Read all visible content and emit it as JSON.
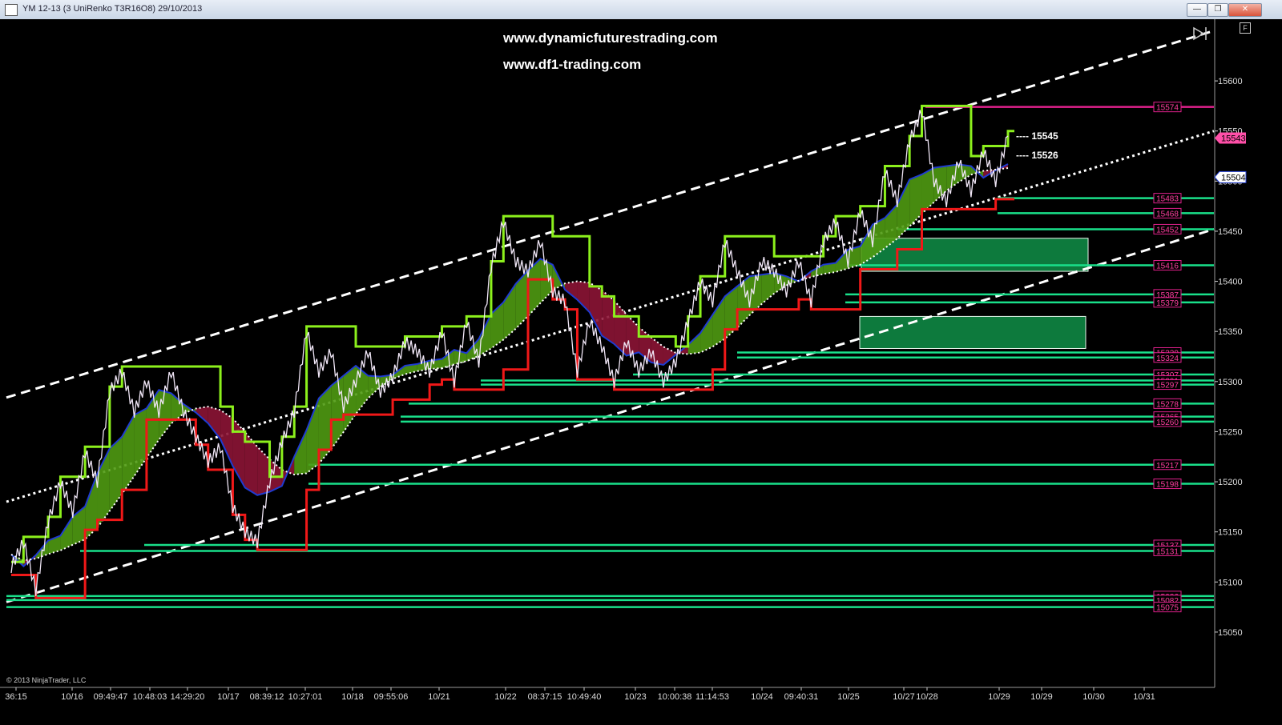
{
  "window": {
    "title": "YM 12-13 (3 UniRenko T3R16O8)  29/10/2013",
    "minimize_glyph": "—",
    "maximize_glyph": "❐",
    "close_glyph": "✕",
    "f_button": "F"
  },
  "chart_data": {
    "type": "line",
    "instrument": "YM 12-13",
    "watermarks": [
      "www.dynamicfuturestrading.com",
      "www.df1-trading.com"
    ],
    "copyright": "© 2013 NinjaTrader, LLC",
    "y_axis": {
      "range": [
        15010,
        15640
      ],
      "ticks": [
        15050,
        15100,
        15150,
        15200,
        15250,
        15300,
        15350,
        15400,
        15450,
        15500,
        15550,
        15600
      ]
    },
    "x_ticks": [
      "36:15",
      "10/16",
      "09:49:47",
      "10:48:03",
      "14:29:20",
      "10/17",
      "08:39:12",
      "10:27:01",
      "10/18",
      "09:55:06",
      "10/21",
      "10/22",
      "08:37:15",
      "10:49:40",
      "10/23",
      "10:00:38",
      "11:14:53",
      "10/24",
      "09:40:31",
      "10/25",
      "10/27",
      "10/28",
      "10/29",
      "10/29",
      "10/30",
      "10/31"
    ],
    "last_price": 15543,
    "marker_price": 15504,
    "target_labels": [
      {
        "value": 15545,
        "text": "---- 15545"
      },
      {
        "value": 15526,
        "text": "---- 15526"
      }
    ],
    "horizontal_levels": [
      {
        "value": 15574,
        "label": "15574"
      },
      {
        "value": 15483,
        "label": "15483"
      },
      {
        "value": 15468,
        "label": "15468"
      },
      {
        "value": 15452,
        "label": "15452"
      },
      {
        "value": 15416,
        "label": "15416"
      },
      {
        "value": 15387,
        "label": "15387"
      },
      {
        "value": 15379,
        "label": "15379"
      },
      {
        "value": 15329,
        "label": "15329"
      },
      {
        "value": 15324,
        "label": "15324"
      },
      {
        "value": 15307,
        "label": "15307"
      },
      {
        "value": 15301,
        "label": "15301"
      },
      {
        "value": 15297,
        "label": "15297"
      },
      {
        "value": 15278,
        "label": "15278"
      },
      {
        "value": 15265,
        "label": "15265"
      },
      {
        "value": 15260,
        "label": "15260"
      },
      {
        "value": 15217,
        "label": "15217"
      },
      {
        "value": 15198,
        "label": "15198"
      },
      {
        "value": 15137,
        "label": "15137"
      },
      {
        "value": 15131,
        "label": "15131"
      },
      {
        "value": 15086,
        "label": "15086"
      },
      {
        "value": 15082,
        "label": "15082"
      },
      {
        "value": 15075,
        "label": "15075"
      }
    ],
    "zones": [
      {
        "y_low": 15410,
        "y_high": 15443
      },
      {
        "y_low": 15333,
        "y_high": 15365
      }
    ],
    "price_path": [
      15115,
      15140,
      15092,
      15160,
      15200,
      15170,
      15230,
      15200,
      15290,
      15310,
      15270,
      15300,
      15270,
      15310,
      15270,
      15245,
      15220,
      15235,
      15175,
      15150,
      15140,
      15200,
      15240,
      15270,
      15350,
      15310,
      15330,
      15275,
      15300,
      15330,
      15290,
      15305,
      15340,
      15330,
      15310,
      15350,
      15300,
      15360,
      15320,
      15415,
      15460,
      15420,
      15410,
      15440,
      15390,
      15380,
      15310,
      15360,
      15335,
      15300,
      15340,
      15310,
      15330,
      15300,
      15320,
      15360,
      15400,
      15380,
      15440,
      15410,
      15380,
      15420,
      15410,
      15390,
      15420,
      15380,
      15440,
      15460,
      15420,
      15470,
      15440,
      15510,
      15480,
      15540,
      15570,
      15500,
      15480,
      15520,
      15490,
      15530,
      15500,
      15545
    ],
    "channel_lines": [
      {
        "style": "dashed",
        "from": 15284,
        "to": 15650
      },
      {
        "style": "dotted",
        "from": 15180,
        "to": 15550
      },
      {
        "style": "dashed",
        "from": 15080,
        "to": 15452
      }
    ]
  }
}
